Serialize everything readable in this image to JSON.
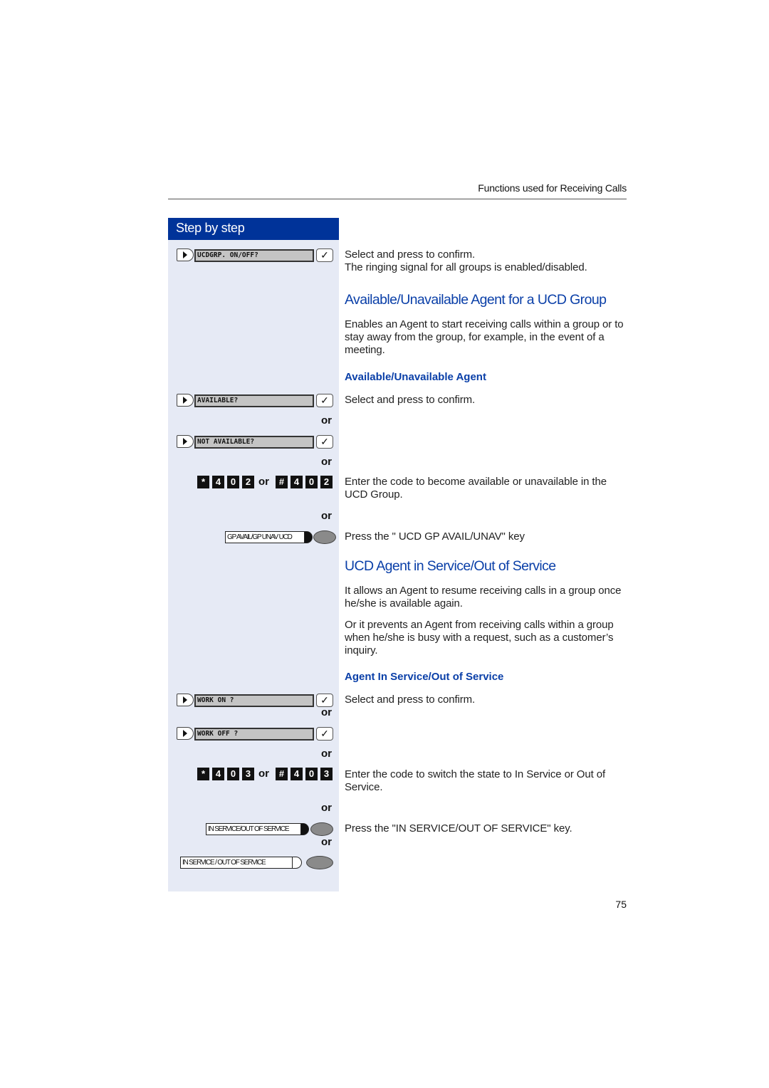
{
  "running_head": "Functions used for Receiving Calls",
  "sidebar": {
    "title": "Step by step",
    "or_label": "or",
    "displays": {
      "ucdgrp": "UCDGRP. ON/OFF?",
      "available": "AVAILABLE?",
      "not_available": "NOT AVAILABLE?",
      "work_on": "WORK ON ?",
      "work_off": "WORK OFF ?"
    },
    "check_glyph": "✓",
    "codes": {
      "avail": {
        "first": [
          "*",
          "4",
          "0",
          "2"
        ],
        "second": [
          "#",
          "4",
          "0",
          "2"
        ]
      },
      "service": {
        "first": [
          "*",
          "4",
          "0",
          "3"
        ],
        "second": [
          "#",
          "4",
          "0",
          "3"
        ]
      }
    },
    "function_keys": {
      "gp_avail": {
        "label": "GP AVAIL/GP UNAV UCD",
        "led": "on"
      },
      "in_service_on": {
        "label": "IN SERVICE/OUT OF SERVICE",
        "led": "on"
      },
      "in_service_off": {
        "label": "IN SERVICE / OUT OF SERVICE",
        "led": "off"
      }
    }
  },
  "content": {
    "ucdgrp_text_1": "Select and press to confirm.",
    "ucdgrp_text_2": "The ringing signal for all groups is enabled/disabled.",
    "section1": {
      "title": "Available/Unavailable Agent for a UCD Group",
      "intro": "Enables an Agent to start receiving calls within a group or to stay away from the group, for example, in the event of a meeting.",
      "subtitle": "Available/Unavailable Agent",
      "select_text": "Select and press to confirm.",
      "code_text": "Enter the code to become available or unavailable in the UCD Group.",
      "key_text": "Press the \" UCD GP AVAIL/UNAV\" key"
    },
    "section2": {
      "title": "UCD Agent in Service/Out of Service",
      "intro1": "It allows an Agent to resume receiving calls in a group once he/she is available again.",
      "intro2": "Or it prevents an Agent from receiving calls within a group when he/she is busy with a request, such as a customer’s inquiry.",
      "subtitle": "Agent In Service/Out of Service",
      "select_text": "Select and press to confirm.",
      "code_text": "Enter the code to switch the state to In Service or Out of Service.",
      "key_text": "Press the \"IN SERVICE/OUT OF SERVICE\" key."
    }
  },
  "page_number": "75",
  "colors": {
    "brand_blue": "#003399",
    "heading_blue": "#0a3fa8",
    "sidebar_bg": "#e6eaf5"
  }
}
